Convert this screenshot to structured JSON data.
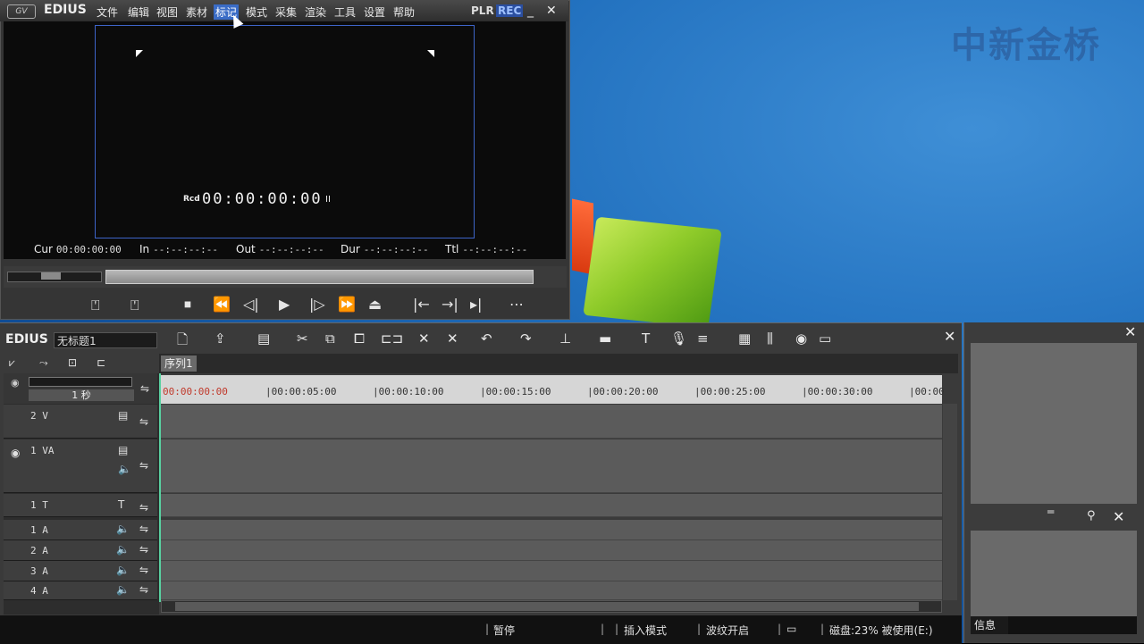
{
  "watermark": "中新金桥",
  "player": {
    "app_logo": "GV",
    "app_title": "EDIUS",
    "menu": [
      "文件",
      "编辑",
      "视图",
      "素材",
      "标记",
      "模式",
      "采集",
      "渲染",
      "工具",
      "设置",
      "帮助"
    ],
    "active_menu": "标记",
    "mode_plr": "PLR",
    "mode_rec": "REC",
    "minimize": "_",
    "close": "✕",
    "rcd_label": "Rcd",
    "rcd_timecode": "00:00:00:00",
    "rcd_suffix": "II",
    "timecodes": {
      "cur_label": "Cur",
      "cur": "00:00:00:00",
      "in_label": "In",
      "in": "--:--:--:--",
      "out_label": "Out",
      "out": "--:--:--:--",
      "dur_label": "Dur",
      "dur": "--:--:--:--",
      "ttl_label": "Ttl",
      "ttl": "--:--:--:--"
    },
    "transport": [
      "⍞",
      "⍞",
      "⏹",
      "⏪",
      "◁|",
      "▶",
      "|▷",
      "⏩",
      "⏏",
      "|←",
      "→|",
      "▸|",
      "⋯"
    ]
  },
  "timeline": {
    "title": "EDIUS",
    "project_name": "无标题1",
    "close": "✕",
    "sequence_tab": "序列1",
    "zoom_label": "1 秒",
    "ruler": [
      "00:00:00:00",
      "|00:00:05:00",
      "|00:00:10:00",
      "|00:00:15:00",
      "|00:00:20:00",
      "|00:00:25:00",
      "|00:00:30:00",
      "|00:00"
    ],
    "tracks": [
      {
        "name": "2 V"
      },
      {
        "name": "1 VA"
      },
      {
        "name": "1 T"
      },
      {
        "name": "1 A"
      },
      {
        "name": "2 A"
      },
      {
        "name": "3 A"
      },
      {
        "name": "4 A"
      }
    ],
    "status": {
      "pause": "暂停",
      "insert_mode": "插入模式",
      "ripple": "波纹开启",
      "disk": "磁盘:23% 被使用(E:)"
    }
  },
  "right_panel": {
    "close": "✕",
    "info_tab": "信息"
  },
  "colors": {
    "accent": "#3a6cc6",
    "monitor_border": "#3d64c8",
    "timecode_red": "#c0392b"
  }
}
